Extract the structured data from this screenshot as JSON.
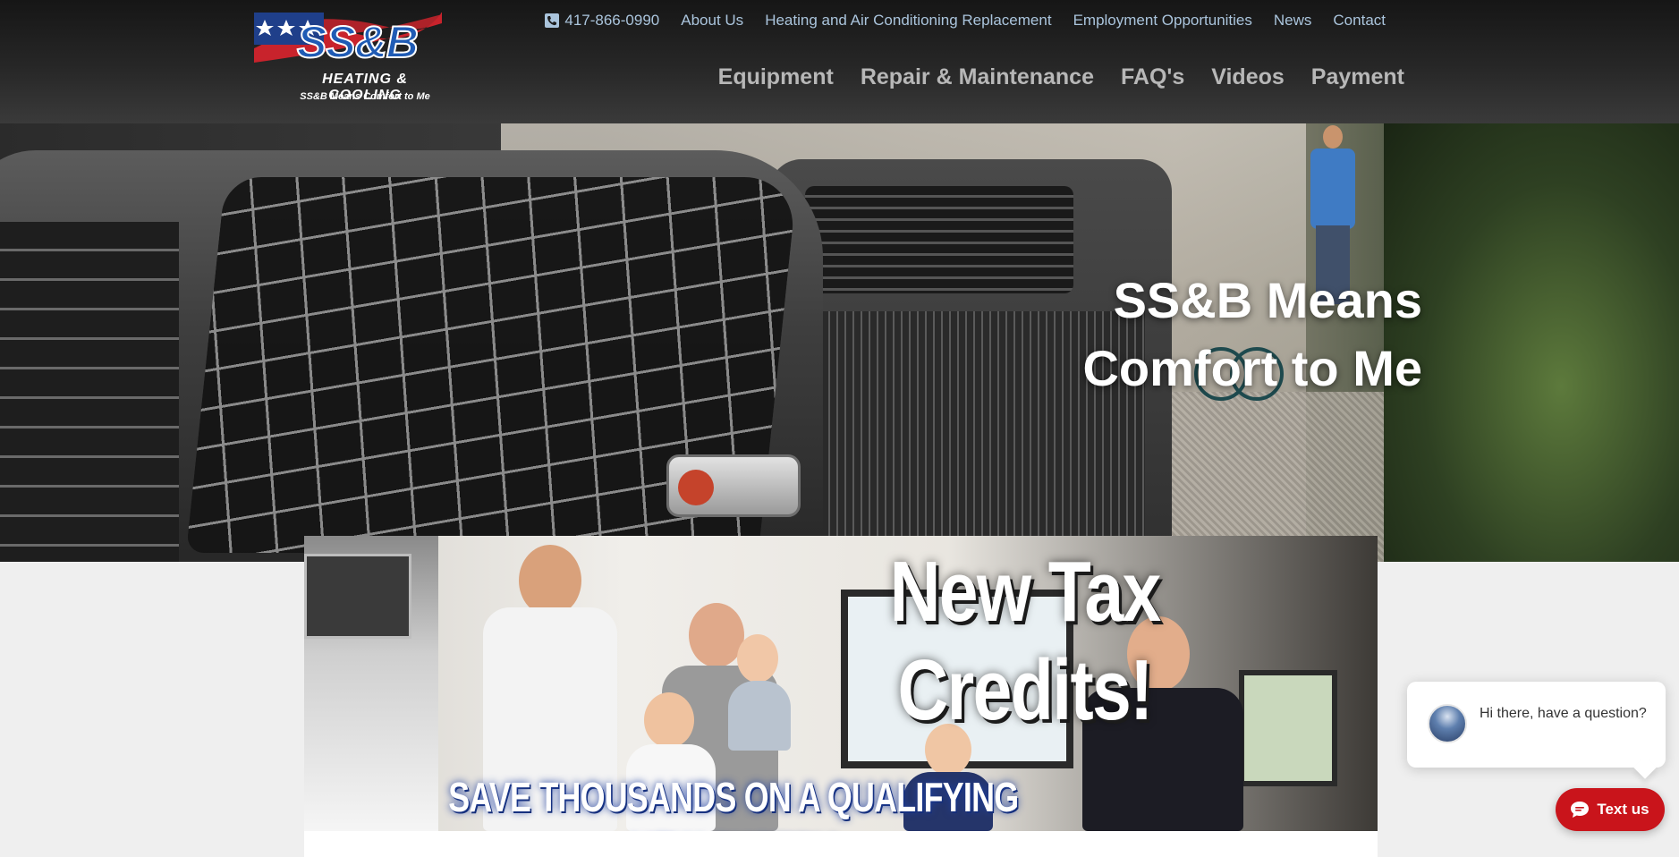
{
  "logo": {
    "main": "SS&B",
    "sub": "HEATING & COOLING",
    "tagline": "SS&B Means Comfort to Me"
  },
  "topnav": {
    "phone": "417-866-0990",
    "items": [
      "About Us",
      "Heating and Air Conditioning Replacement",
      "Employment Opportunities",
      "News",
      "Contact"
    ]
  },
  "mainnav": {
    "items": [
      "Equipment",
      "Repair & Maintenance",
      "FAQ's",
      "Videos",
      "Payment"
    ]
  },
  "hero": {
    "line1": "SS&B Means",
    "line2": "Comfort to Me"
  },
  "promo": {
    "title": "New Tax Credits!",
    "subtitle": "SAVE THOUSANDS ON A QUALIFYING NEW SYSTEM"
  },
  "chat": {
    "message": "Hi there, have a question?",
    "button": "Text us"
  },
  "icons": {
    "phone": "phone-icon",
    "chat": "chat-icon",
    "trane": "trane-logo-icon"
  },
  "colors": {
    "header_bg": "#262626",
    "topnav_link": "#aac4dc",
    "mainnav_link": "#b7b7b7",
    "chat_button": "#c9141b",
    "logo_blue": "#1f5bb5"
  }
}
